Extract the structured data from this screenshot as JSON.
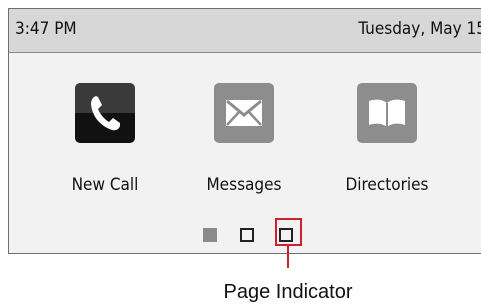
{
  "status_bar": {
    "time": "3:47 PM",
    "date": "Tuesday, May 15"
  },
  "apps": [
    {
      "label": "New Call",
      "icon": "phone-handset-icon"
    },
    {
      "label": "Messages",
      "icon": "envelope-icon"
    },
    {
      "label": "Directories",
      "icon": "open-book-icon"
    }
  ],
  "pager": {
    "page_count": 3,
    "current_page": 1
  },
  "annotation": {
    "label": "Page Indicator",
    "color": "#d01f2e"
  }
}
